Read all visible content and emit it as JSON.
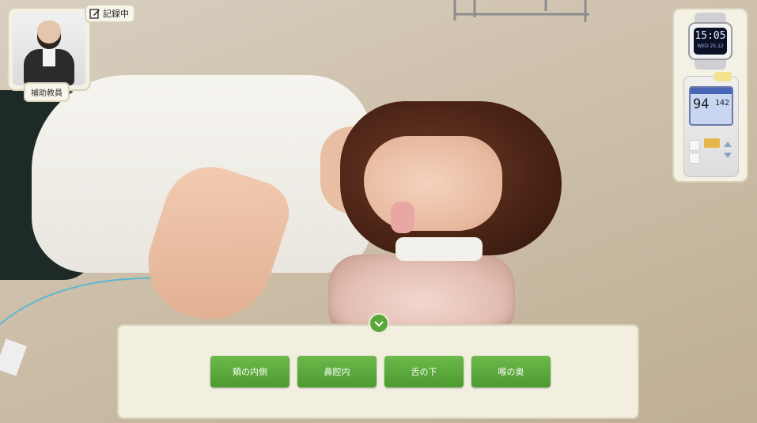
{
  "tutor": {
    "name_label": "補助教員",
    "record_status": "記録中"
  },
  "devices": {
    "watch": {
      "time": "15:05",
      "date": "WED 25.12"
    },
    "oximeter": {
      "spo2": "94",
      "pulse": "142"
    }
  },
  "choices": {
    "options": [
      {
        "label": "頬の内側"
      },
      {
        "label": "鼻腔内"
      },
      {
        "label": "舌の下"
      },
      {
        "label": "喉の奥"
      }
    ]
  },
  "colors": {
    "accent_green": "#5aa63a",
    "panel_bg": "#f2efe1",
    "panel_border": "#d8d2bb"
  },
  "icons": {
    "record": "pencil-icon",
    "collapse": "chevron-down-icon"
  }
}
